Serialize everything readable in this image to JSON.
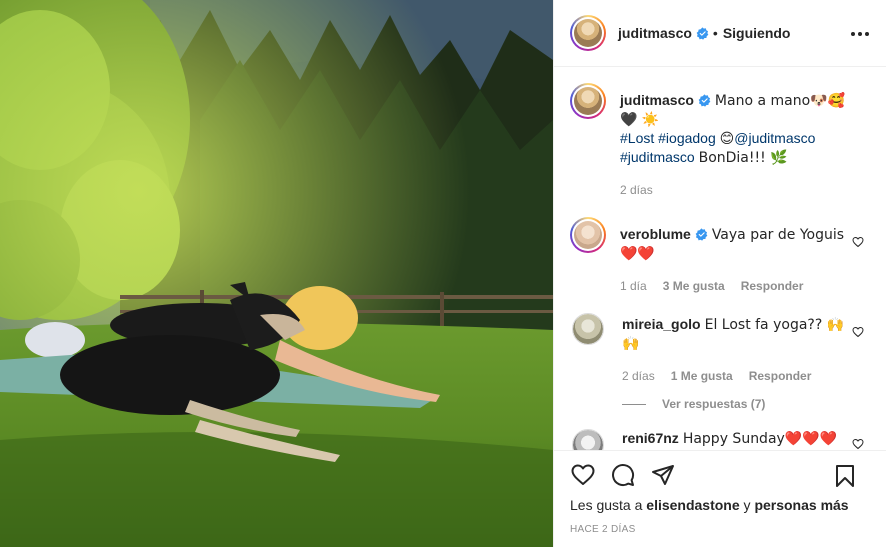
{
  "post": {
    "image_description_icon": "photo"
  },
  "header": {
    "username": "juditmasco",
    "separator": "•",
    "follow_status": "Siguiendo"
  },
  "caption": {
    "username": "juditmasco",
    "text_1": "Mano a mano🐶🥰🖤 ☀️",
    "hashtag_1": "#Lost",
    "hashtag_2": "#iogadog",
    "text_2": "😊",
    "mention": "@juditmasco",
    "hashtag_3": "#juditmasco",
    "text_3": "BonDia!!! 🌿",
    "time": "2 días"
  },
  "comments": [
    {
      "username": "veroblume",
      "text": "Vaya par de Yoguis ❤️❤️",
      "time": "1 día",
      "likes": "3 Me gusta",
      "reply": "Responder"
    },
    {
      "username": "mireia_golo",
      "text": "El Lost fa yoga?? 🙌 🙌",
      "time": "2 días",
      "likes": "1 Me gusta",
      "reply": "Responder",
      "view_replies": "Ver respuestas (7)"
    },
    {
      "username": "reni67nz",
      "text": "Happy Sunday❤️❤️❤️❤️ ❤️❤️❤️❤️❤️❤️❤️"
    }
  ],
  "actions": {
    "likes_prefix": "Les gusta a",
    "likes_user": "elisendastone",
    "likes_and": "y",
    "likes_others": "personas más",
    "time_ago": "HACE 2 DÍAS"
  },
  "colors": {
    "link": "#00376b",
    "verified": "#3897f0",
    "muted": "#8e8e8e"
  }
}
